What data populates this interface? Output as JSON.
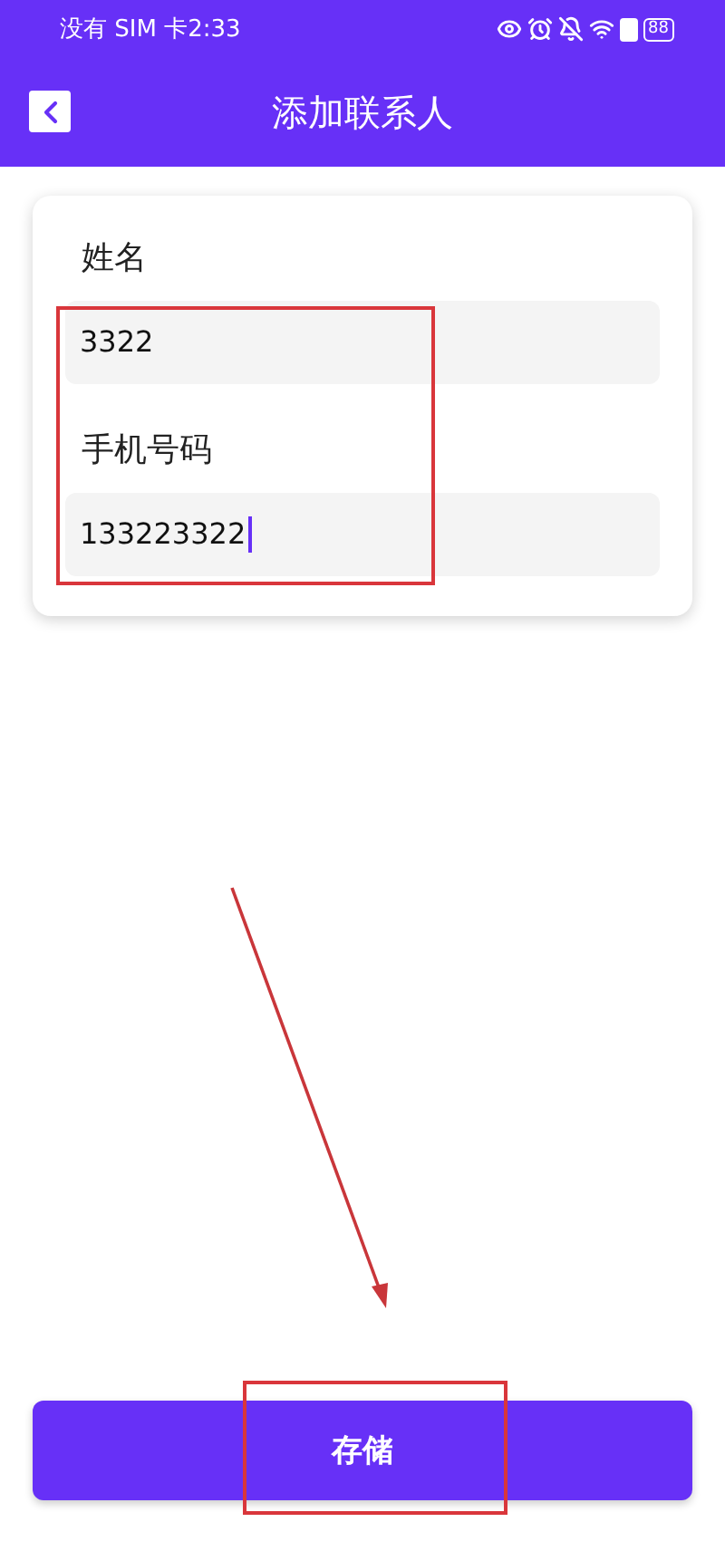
{
  "status_bar": {
    "carrier_time": "没有 SIM 卡2:33",
    "battery": "88"
  },
  "header": {
    "title": "添加联系人"
  },
  "form": {
    "fields": [
      {
        "label": "姓名",
        "value": "3322",
        "focused": false
      },
      {
        "label": "手机号码",
        "value": "133223322",
        "focused": true
      }
    ]
  },
  "save_button": {
    "label": "存储"
  }
}
